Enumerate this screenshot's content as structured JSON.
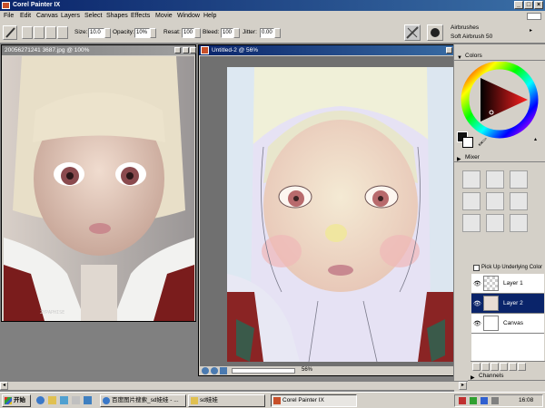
{
  "app": {
    "title": "Corel Painter IX"
  },
  "menu": [
    "File",
    "Edit",
    "Canvas",
    "Layers",
    "Select",
    "Shapes",
    "Effects",
    "Movie",
    "Window",
    "Help"
  ],
  "propbar": {
    "size_label": "Size:",
    "size_value": "10.0",
    "opacity_label": "Opacity:",
    "opacity_value": "10%",
    "resat_label": "Resat:",
    "resat_value": "100",
    "bleed_label": "Bleed:",
    "bleed_value": "100",
    "jitter_label": "Jitter:",
    "jitter_value": "0.00",
    "brush_category": "Airbrushes",
    "brush_variant": "Soft Airbrush 50"
  },
  "ref_window": {
    "title": "20056271241 3687.jpg @ 100%",
    "watermark": "ZYPAPHISE"
  },
  "canvas_window": {
    "title": "Untitled-2 @ 56%",
    "zoom": "56%"
  },
  "panels": {
    "colors": "Colors",
    "mixer": "Mixer",
    "pick_up": "Pick Up Underlying Color",
    "channels": "Channels"
  },
  "layers": [
    {
      "name": "Layer 1",
      "selected": false
    },
    {
      "name": "Layer 2",
      "selected": true
    },
    {
      "name": "Canvas",
      "selected": false
    }
  ],
  "taskbar": {
    "start": "开始",
    "tasks": [
      "百度图片搜索_sd娃娃 - ...",
      "sd娃娃",
      "Corel Painter IX"
    ],
    "clock": "16:08"
  },
  "colors": {
    "titlebar": "#0a246a",
    "selected_layer": "#0a246a",
    "panel_bg": "#d4d0c8"
  }
}
